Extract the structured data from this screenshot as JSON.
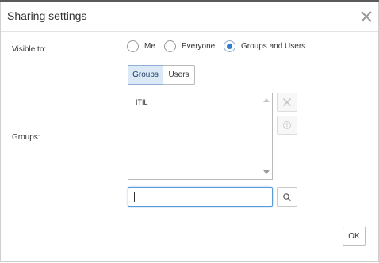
{
  "dialog": {
    "title": "Sharing settings",
    "close_icon": "close-icon"
  },
  "visibility": {
    "label": "Visible to:",
    "options": [
      {
        "label": "Me",
        "checked": false
      },
      {
        "label": "Everyone",
        "checked": false
      },
      {
        "label": "Groups and Users",
        "checked": true
      }
    ]
  },
  "tabs": [
    {
      "label": "Groups",
      "active": true
    },
    {
      "label": "Users",
      "active": false
    }
  ],
  "groups": {
    "label": "Groups:",
    "items": [
      "ITIL"
    ]
  },
  "side_buttons": {
    "remove_icon": "close-icon",
    "info_icon": "info-icon"
  },
  "search": {
    "value": "",
    "button_icon": "search-icon"
  },
  "footer": {
    "ok_label": "OK"
  },
  "colors": {
    "accent": "#2f7fd1",
    "active_tab_bg": "#dbe8f6",
    "focus_border": "#5b9ad8"
  }
}
